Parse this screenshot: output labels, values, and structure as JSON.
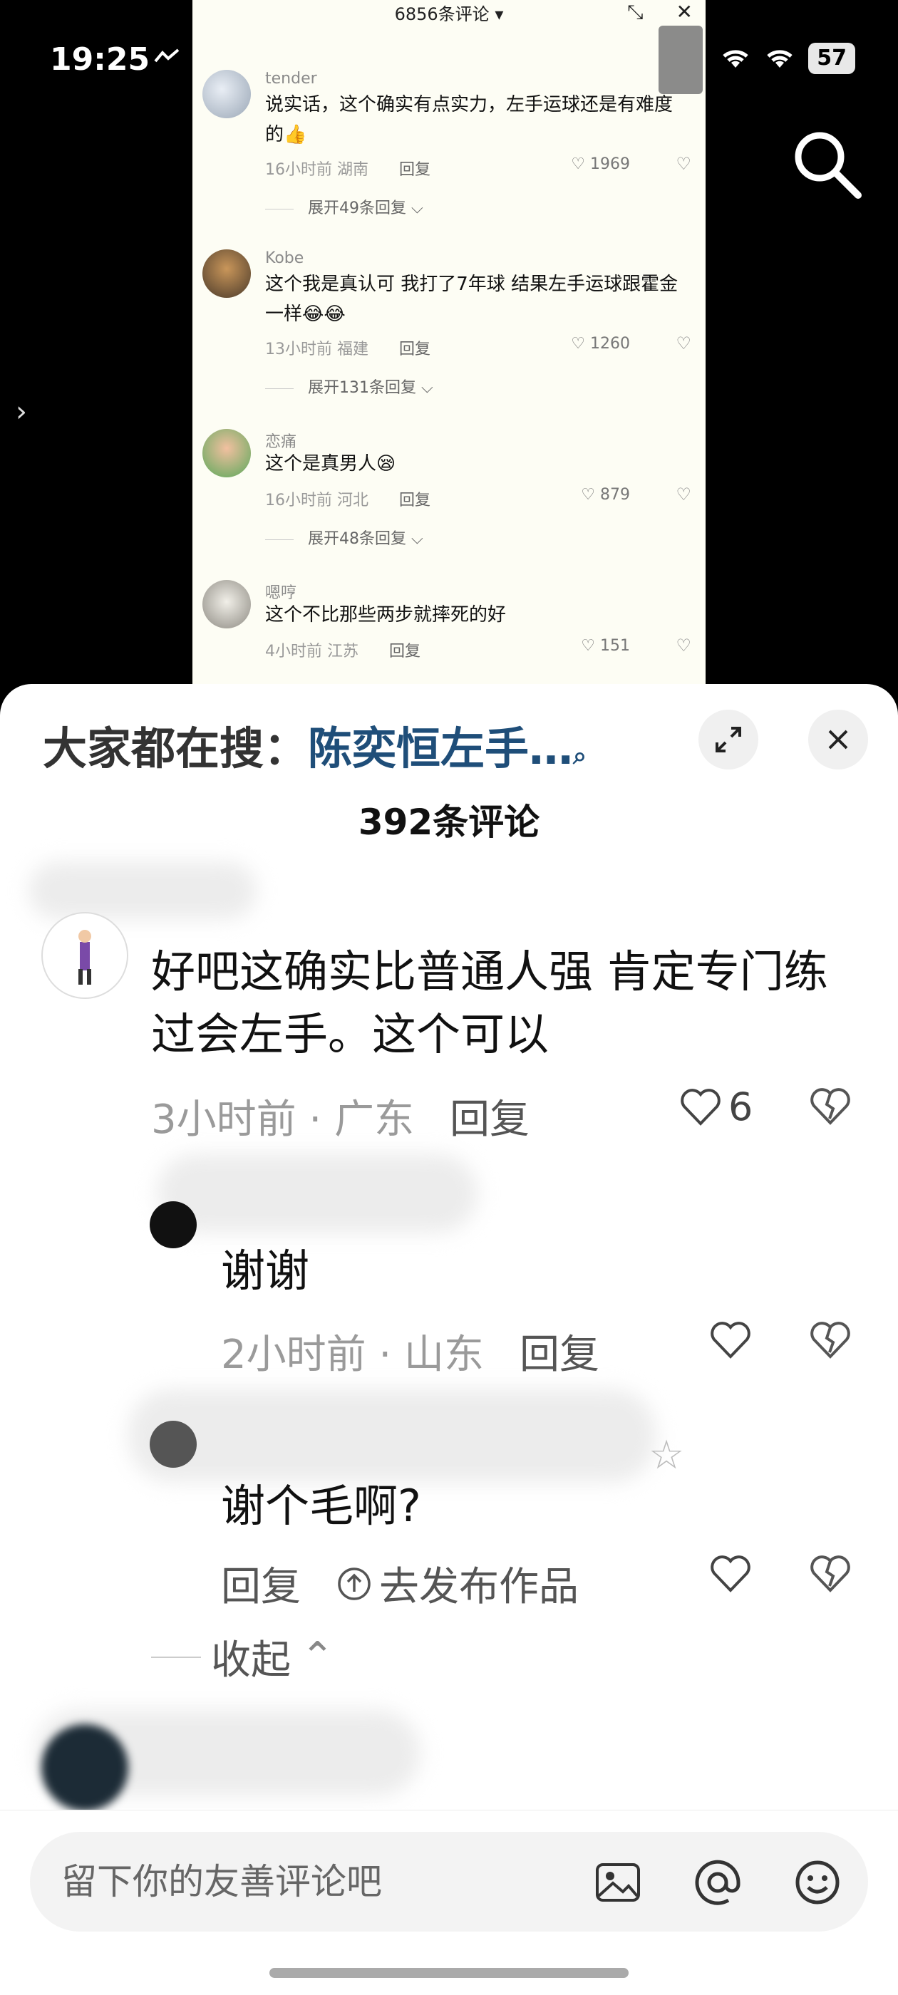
{
  "status": {
    "time": "19:25",
    "battery": "57"
  },
  "inner": {
    "title": "6856条评论 ▾",
    "comments": [
      {
        "user": "tender",
        "text": "说实话，这个确实有点实力，左手运球还是有难度的👍",
        "time": "16小时前",
        "region": "湖南",
        "reply": "回复",
        "likes": "1969",
        "expand": "展开49条回复 ⌵"
      },
      {
        "user": "Kobe",
        "text": "这个我是真认可 我打了7年球 结果左手运球跟霍金一样😂😂",
        "time": "13小时前",
        "region": "福建",
        "reply": "回复",
        "likes": "1260",
        "expand": "展开131条回复 ⌵"
      },
      {
        "user": "恋痛",
        "text": "这个是真男人😪",
        "time": "16小时前",
        "region": "河北",
        "reply": "回复",
        "likes": "879",
        "expand": "展开48条回复 ⌵"
      },
      {
        "user": "嗯哼",
        "text": "这个不比那些两步就摔死的好",
        "time": "4小时前",
        "region": "江苏",
        "reply": "回复",
        "likes": "151"
      }
    ]
  },
  "sheet": {
    "hot_label": "大家都在搜：",
    "hot_term": "陈奕恒左手…",
    "title": "392条评论",
    "main_comment": {
      "text": "好吧这确实比普通人强  肯定专门练过会左手。这个可以",
      "time": "3小时前 · 广东",
      "reply": "回复",
      "likes": "6"
    },
    "reply1": {
      "text": "谢谢",
      "time": "2小时前 · 山东",
      "reply": "回复"
    },
    "reply2": {
      "text": "谢个毛啊?",
      "reply": "回复",
      "publish": "去发布作品"
    },
    "collapse": "收起"
  },
  "input": {
    "placeholder": "留下你的友善评论吧"
  }
}
